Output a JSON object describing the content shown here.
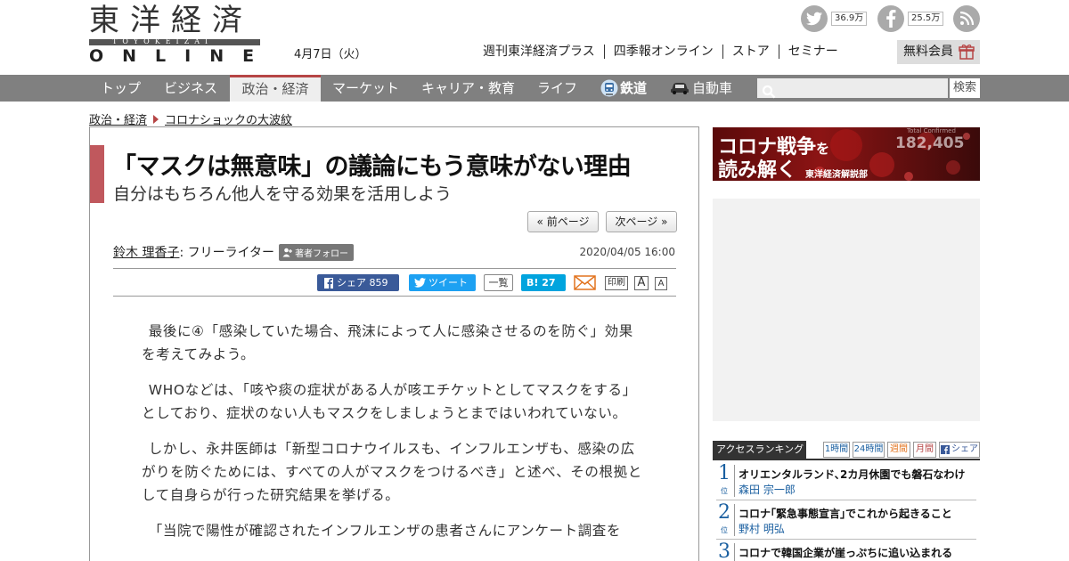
{
  "logo": {
    "kanji": "東洋経済",
    "romaji": "TOYOKEIZAI",
    "online": "ONLINE"
  },
  "header": {
    "date": "4月7日（火）",
    "links": [
      "週刊東洋経済プラス",
      "四季報オンライン",
      "ストア",
      "セミナー"
    ],
    "member_label": "無料会員"
  },
  "social": {
    "twitter_count": "36.9万",
    "facebook_count": "25.5万"
  },
  "nav": {
    "items": [
      "トップ",
      "ビジネス",
      "政治・経済",
      "マーケット",
      "キャリア・教育",
      "ライフ",
      "鉄道",
      "自動車"
    ],
    "search_label": "検索"
  },
  "breadcrumb": {
    "category": "政治・経済",
    "series": "コロナショックの大波紋"
  },
  "article": {
    "title": "「マスクは無意味」の議論にもう意味がない理由",
    "subtitle": "自分はもちろん他人を守る効果を活用しよう",
    "prev_label": "« 前ページ",
    "next_label": "次ページ »",
    "author_name": "鈴木 理香子",
    "author_role": " : フリーライター",
    "follow_label": "著者フォロー",
    "pubdate": "2020/04/05 16:00",
    "share_fb": "シェア  859",
    "share_tw": "ツイート",
    "share_list": "一覧",
    "share_hb": "B! 27",
    "print_label": "印刷",
    "font_big": "A",
    "font_small": "A",
    "paragraphs": [
      "最後に④「感染していた場合、飛沫によって人に感染させるのを防ぐ」効果を考えてみよう。",
      "WHOなどは、「咳や痰の症状がある人が咳エチケットとしてマスクをする」としており、症状のない人もマスクをしましょうとまではいわれていない。",
      "しかし、永井医師は「新型コロナウイルスも、インフルエンザも、感染の広がりを防ぐためには、すべての人がマスクをつけるべき」と述べ、その根拠として自身らが行った研究結果を挙げる。",
      "「当院で陽性が確認されたインフルエンザの患者さんにアンケート調査を"
    ]
  },
  "banner": {
    "line1": "コロナ戦争",
    "line1_small": "を",
    "line2": "読み解く",
    "sub": "東洋経済解説部",
    "figure": "182,405",
    "figure_label": "Total Confirmed"
  },
  "ranking": {
    "title": "アクセスランキング",
    "tabs": [
      "1時間",
      "24時間",
      "週間",
      "月間",
      "シェア"
    ],
    "rank_suffix": "位",
    "items": [
      {
        "rank": "1",
        "title": "オリエンタルランド､2カ月休園でも磐石なわけ",
        "author": "森田 宗一郎"
      },
      {
        "rank": "2",
        "title": "コロナ｢緊急事態宣言｣でこれから起きること",
        "author": "野村 明弘"
      },
      {
        "rank": "3",
        "title": "コロナで韓国企業が崖っぷちに追い込まれる",
        "author": ""
      }
    ]
  }
}
